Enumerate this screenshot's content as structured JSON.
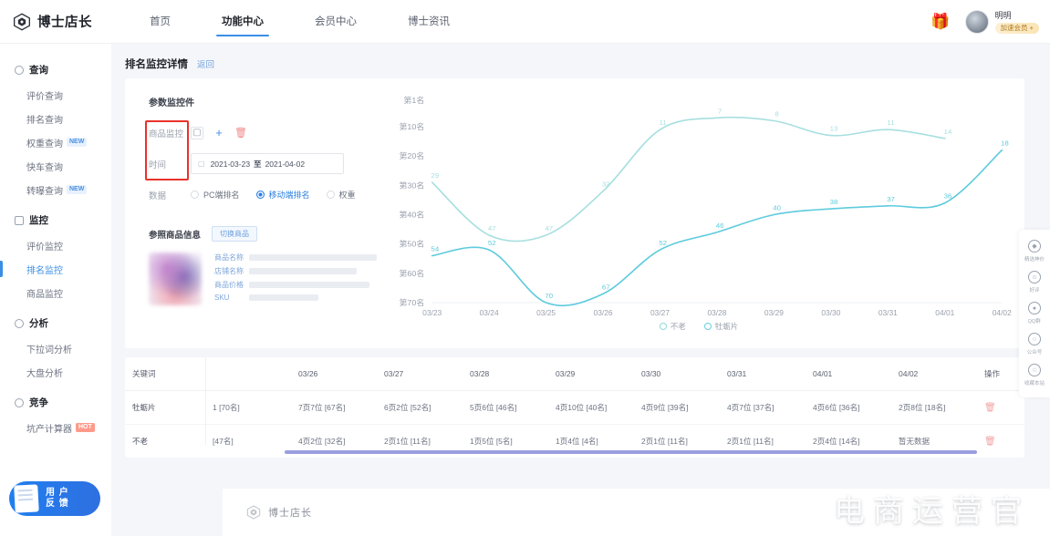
{
  "brand": {
    "name": "博士店长",
    "logo_icon": "diamond-logo-icon"
  },
  "topnav": {
    "items": [
      {
        "label": "首页",
        "active": false
      },
      {
        "label": "功能中心",
        "active": true
      },
      {
        "label": "会员中心",
        "active": false
      },
      {
        "label": "博士资讯",
        "active": false
      }
    ],
    "gift_icon": "gift-icon",
    "user": {
      "name": "明明",
      "badge": "加速会员 +"
    }
  },
  "sidebar": {
    "groups": [
      {
        "title": "查询",
        "icon": "search-circle-icon",
        "items": [
          {
            "label": "评价查询",
            "tag": "",
            "active": false
          },
          {
            "label": "排名查询",
            "tag": "",
            "active": false
          },
          {
            "label": "权重查询",
            "tag": "NEW",
            "active": false
          },
          {
            "label": "快车查询",
            "tag": "",
            "active": false
          },
          {
            "label": "转曝查询",
            "tag": "NEW",
            "active": false
          }
        ]
      },
      {
        "title": "监控",
        "icon": "monitor-icon",
        "items": [
          {
            "label": "评价监控",
            "tag": "",
            "active": false
          },
          {
            "label": "排名监控",
            "tag": "",
            "active": true
          },
          {
            "label": "商品监控",
            "tag": "",
            "active": false
          }
        ]
      },
      {
        "title": "分析",
        "icon": "clock-icon",
        "items": [
          {
            "label": "下拉词分析",
            "tag": "",
            "active": false
          },
          {
            "label": "大盘分析",
            "tag": "",
            "active": false
          }
        ]
      },
      {
        "title": "竞争",
        "icon": "compete-icon",
        "items": [
          {
            "label": "坑产计算器",
            "tag": "HOT",
            "active": false
          }
        ]
      }
    ],
    "feedback": {
      "line1": "用 户",
      "line2": "反 馈",
      "icon": "feedback-card-icon"
    }
  },
  "page": {
    "title": "排名监控详情",
    "back": "返回"
  },
  "form": {
    "title": "参数监控件",
    "rows": {
      "product_label": "商品监控",
      "time_label": "时间",
      "data_label": "数据"
    },
    "actions": {
      "copy_icon": "copy-icon",
      "add_icon": "plus-icon",
      "delete_icon": "trash-icon"
    },
    "date": {
      "calendar_icon": "calendar-icon",
      "start": "2021-03-23",
      "separator": "至",
      "end": "2021-04-02"
    },
    "radios": [
      {
        "label": "PC端排名",
        "checked": false
      },
      {
        "label": "移动端排名",
        "checked": true
      },
      {
        "label": "权重",
        "checked": false
      }
    ],
    "highlight_color": "#e8322a"
  },
  "product": {
    "title": "参照商品信息",
    "switch_label": "切换商品",
    "fields": [
      {
        "key": "商品名称",
        "value": ""
      },
      {
        "key": "店铺名称",
        "value": ""
      },
      {
        "key": "商品价格",
        "value": ""
      },
      {
        "key": "SKU",
        "value": ""
      }
    ]
  },
  "chart_data": {
    "type": "line",
    "title": "",
    "xlabel": "",
    "ylabel": "",
    "x": [
      "03/23",
      "03/24",
      "03/25",
      "03/26",
      "03/27",
      "03/28",
      "03/29",
      "03/30",
      "03/31",
      "04/01",
      "04/02"
    ],
    "ytick_labels": [
      "第1名",
      "第10名",
      "第20名",
      "第30名",
      "第40名",
      "第50名",
      "第60名",
      "第70名"
    ],
    "ytick_values": [
      1,
      10,
      20,
      30,
      40,
      50,
      60,
      70
    ],
    "ylim": [
      1,
      70
    ],
    "y_inverted": true,
    "grid": false,
    "legend_position": "bottom",
    "series": [
      {
        "name": "不老",
        "color": "#a8dfe0",
        "values": [
          29,
          47,
          47,
          32,
          11,
          7,
          8,
          13,
          11,
          14,
          null
        ],
        "point_labels": [
          "29",
          "47",
          "47",
          "32",
          "11",
          "7",
          "8",
          "13",
          "11",
          "14",
          ""
        ]
      },
      {
        "name": "牡蛎片",
        "color": "#5ecbdd",
        "values": [
          54,
          52,
          70,
          67,
          52,
          46,
          40,
          38,
          37,
          36,
          18
        ],
        "point_labels": [
          "54",
          "52",
          "70",
          "67",
          "52",
          "46",
          "40",
          "38",
          "37",
          "36",
          "18"
        ]
      }
    ],
    "legend": [
      {
        "label": "不老",
        "color": "#a8dfe0"
      },
      {
        "label": "牡蛎片",
        "color": "#5ecbdd"
      }
    ]
  },
  "table": {
    "columns": [
      "关键词",
      "",
      "03/26",
      "03/27",
      "03/28",
      "03/29",
      "03/30",
      "03/31",
      "04/01",
      "04/02",
      "操作"
    ],
    "rows": [
      {
        "keyword": "牡蛎片",
        "cells": [
          "1 [70名]",
          "7页7位 [67名]",
          "6页2位 [52名]",
          "5页6位 [46名]",
          "4页10位 [40名]",
          "4页9位 [39名]",
          "4页7位 [37名]",
          "4页6位 [36名]",
          "2页8位 [18名]"
        ],
        "delete_icon": "trash-icon"
      },
      {
        "keyword": "不老",
        "cells": [
          "[47名]",
          "4页2位 [32名]",
          "2页1位 [11名]",
          "1页5位 [5名]",
          "1页4位 [4名]",
          "2页1位 [11名]",
          "2页1位 [11名]",
          "2页4位 [14名]",
          "暂无数据"
        ],
        "delete_icon": "trash-icon"
      }
    ],
    "scrollbar_color": "#9a9ee0"
  },
  "rightbar": {
    "items": [
      {
        "icon": "shield-icon",
        "label": "精选神价"
      },
      {
        "icon": "thumbs-up-icon",
        "label": "好评"
      },
      {
        "icon": "qq-group-icon",
        "label": "QQ群"
      },
      {
        "icon": "wechat-icon",
        "label": "公众号"
      },
      {
        "icon": "star-icon",
        "label": "收藏本站"
      }
    ]
  },
  "footer": {
    "name": "博士店长",
    "logo_icon": "diamond-logo-icon"
  },
  "watermark": {
    "text": "电商运营官"
  }
}
